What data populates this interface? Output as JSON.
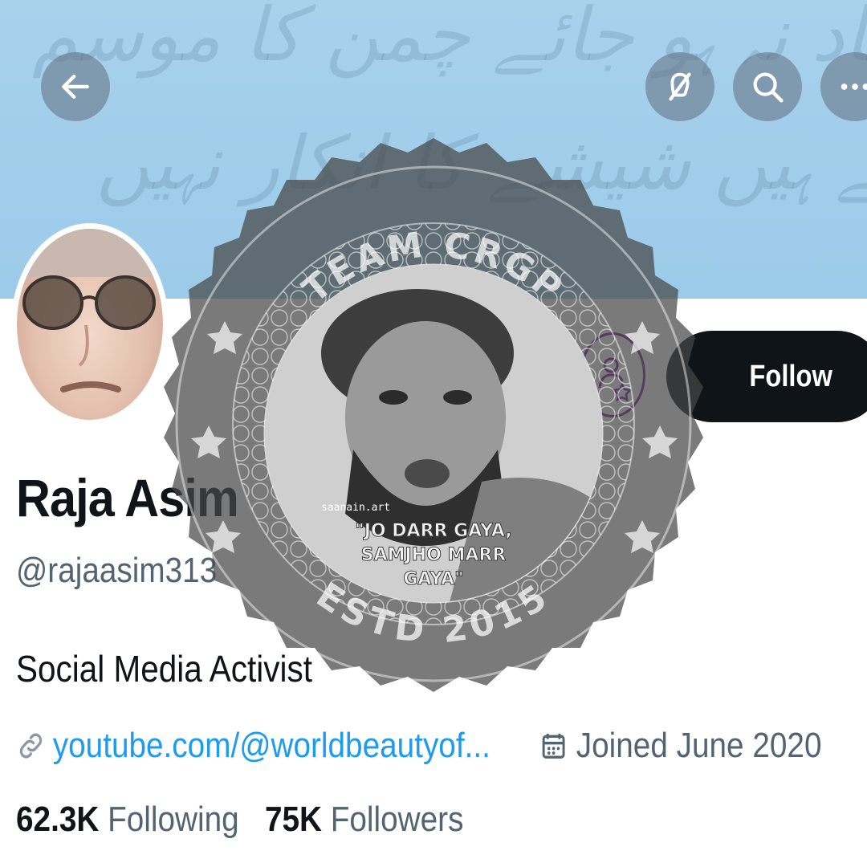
{
  "header": {
    "back_icon": "arrow-left-icon",
    "action_icons": [
      "no-notifications-icon",
      "search-icon",
      "more-icon"
    ]
  },
  "profile": {
    "name": "Raja Asim",
    "handle": "@rajaasim313",
    "bio": "Social Media Activist",
    "link": "youtube.com/@worldbeautyof...",
    "joined": "Joined June 2020",
    "following_count": "62.3K",
    "following_label": "Following",
    "followers_count": "75K",
    "followers_label": "Followers",
    "follow_button_label": "Follow"
  },
  "watermark": {
    "top_text": "TEAM CRGP",
    "bottom_text": "ESTD 2015",
    "quote_lines": [
      "\"JO DARR GAYA,",
      "SAMJHO MARR",
      "GAYA\""
    ],
    "signature": "saanain.art"
  },
  "colors": {
    "accent": "#1d9bf0",
    "banner": "#a8d1ec",
    "text_primary": "#0f1419",
    "text_secondary": "#536471",
    "follow_bg": "#0f1419",
    "seal_grey": "#6e6e6e"
  }
}
